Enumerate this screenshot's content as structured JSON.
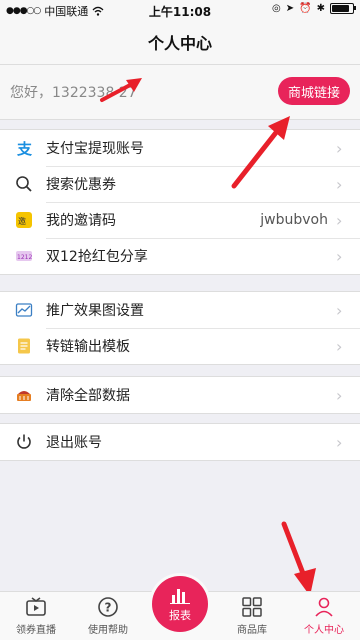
{
  "status_bar": {
    "carrier": "中国联通",
    "time": "上午11:08",
    "battery_level": 0.85
  },
  "header": {
    "title": "个人中心"
  },
  "user": {
    "greeting": "您好，1322338 27",
    "mall_link_button": "商城链接"
  },
  "menu_groups": [
    [
      {
        "label": "支付宝提现账号",
        "icon": "alipay-icon"
      },
      {
        "label": "搜索优惠券",
        "icon": "search-icon"
      },
      {
        "label": "我的邀请码",
        "icon": "invite-icon",
        "value": "jwbubvoh"
      },
      {
        "label": "双12抢红包分享",
        "icon": "share-icon"
      }
    ],
    [
      {
        "label": "推广效果图设置",
        "icon": "chart-image-icon"
      },
      {
        "label": "转链输出模板",
        "icon": "template-icon"
      }
    ],
    [
      {
        "label": "清除全部数据",
        "icon": "clear-data-icon"
      }
    ],
    [
      {
        "label": "退出账号",
        "icon": "power-icon"
      }
    ]
  ],
  "tab_bar": {
    "tabs": [
      {
        "label": "领券直播",
        "icon": "live-tv-icon"
      },
      {
        "label": "使用帮助",
        "icon": "help-icon"
      },
      {
        "label": "报表",
        "icon": "report-chart-icon"
      },
      {
        "label": "商品库",
        "icon": "grid-icon"
      },
      {
        "label": "个人中心",
        "icon": "user-icon"
      }
    ],
    "active_index": 4
  },
  "colors": {
    "accent": "#e8245a",
    "arrow": "#e8202a"
  }
}
